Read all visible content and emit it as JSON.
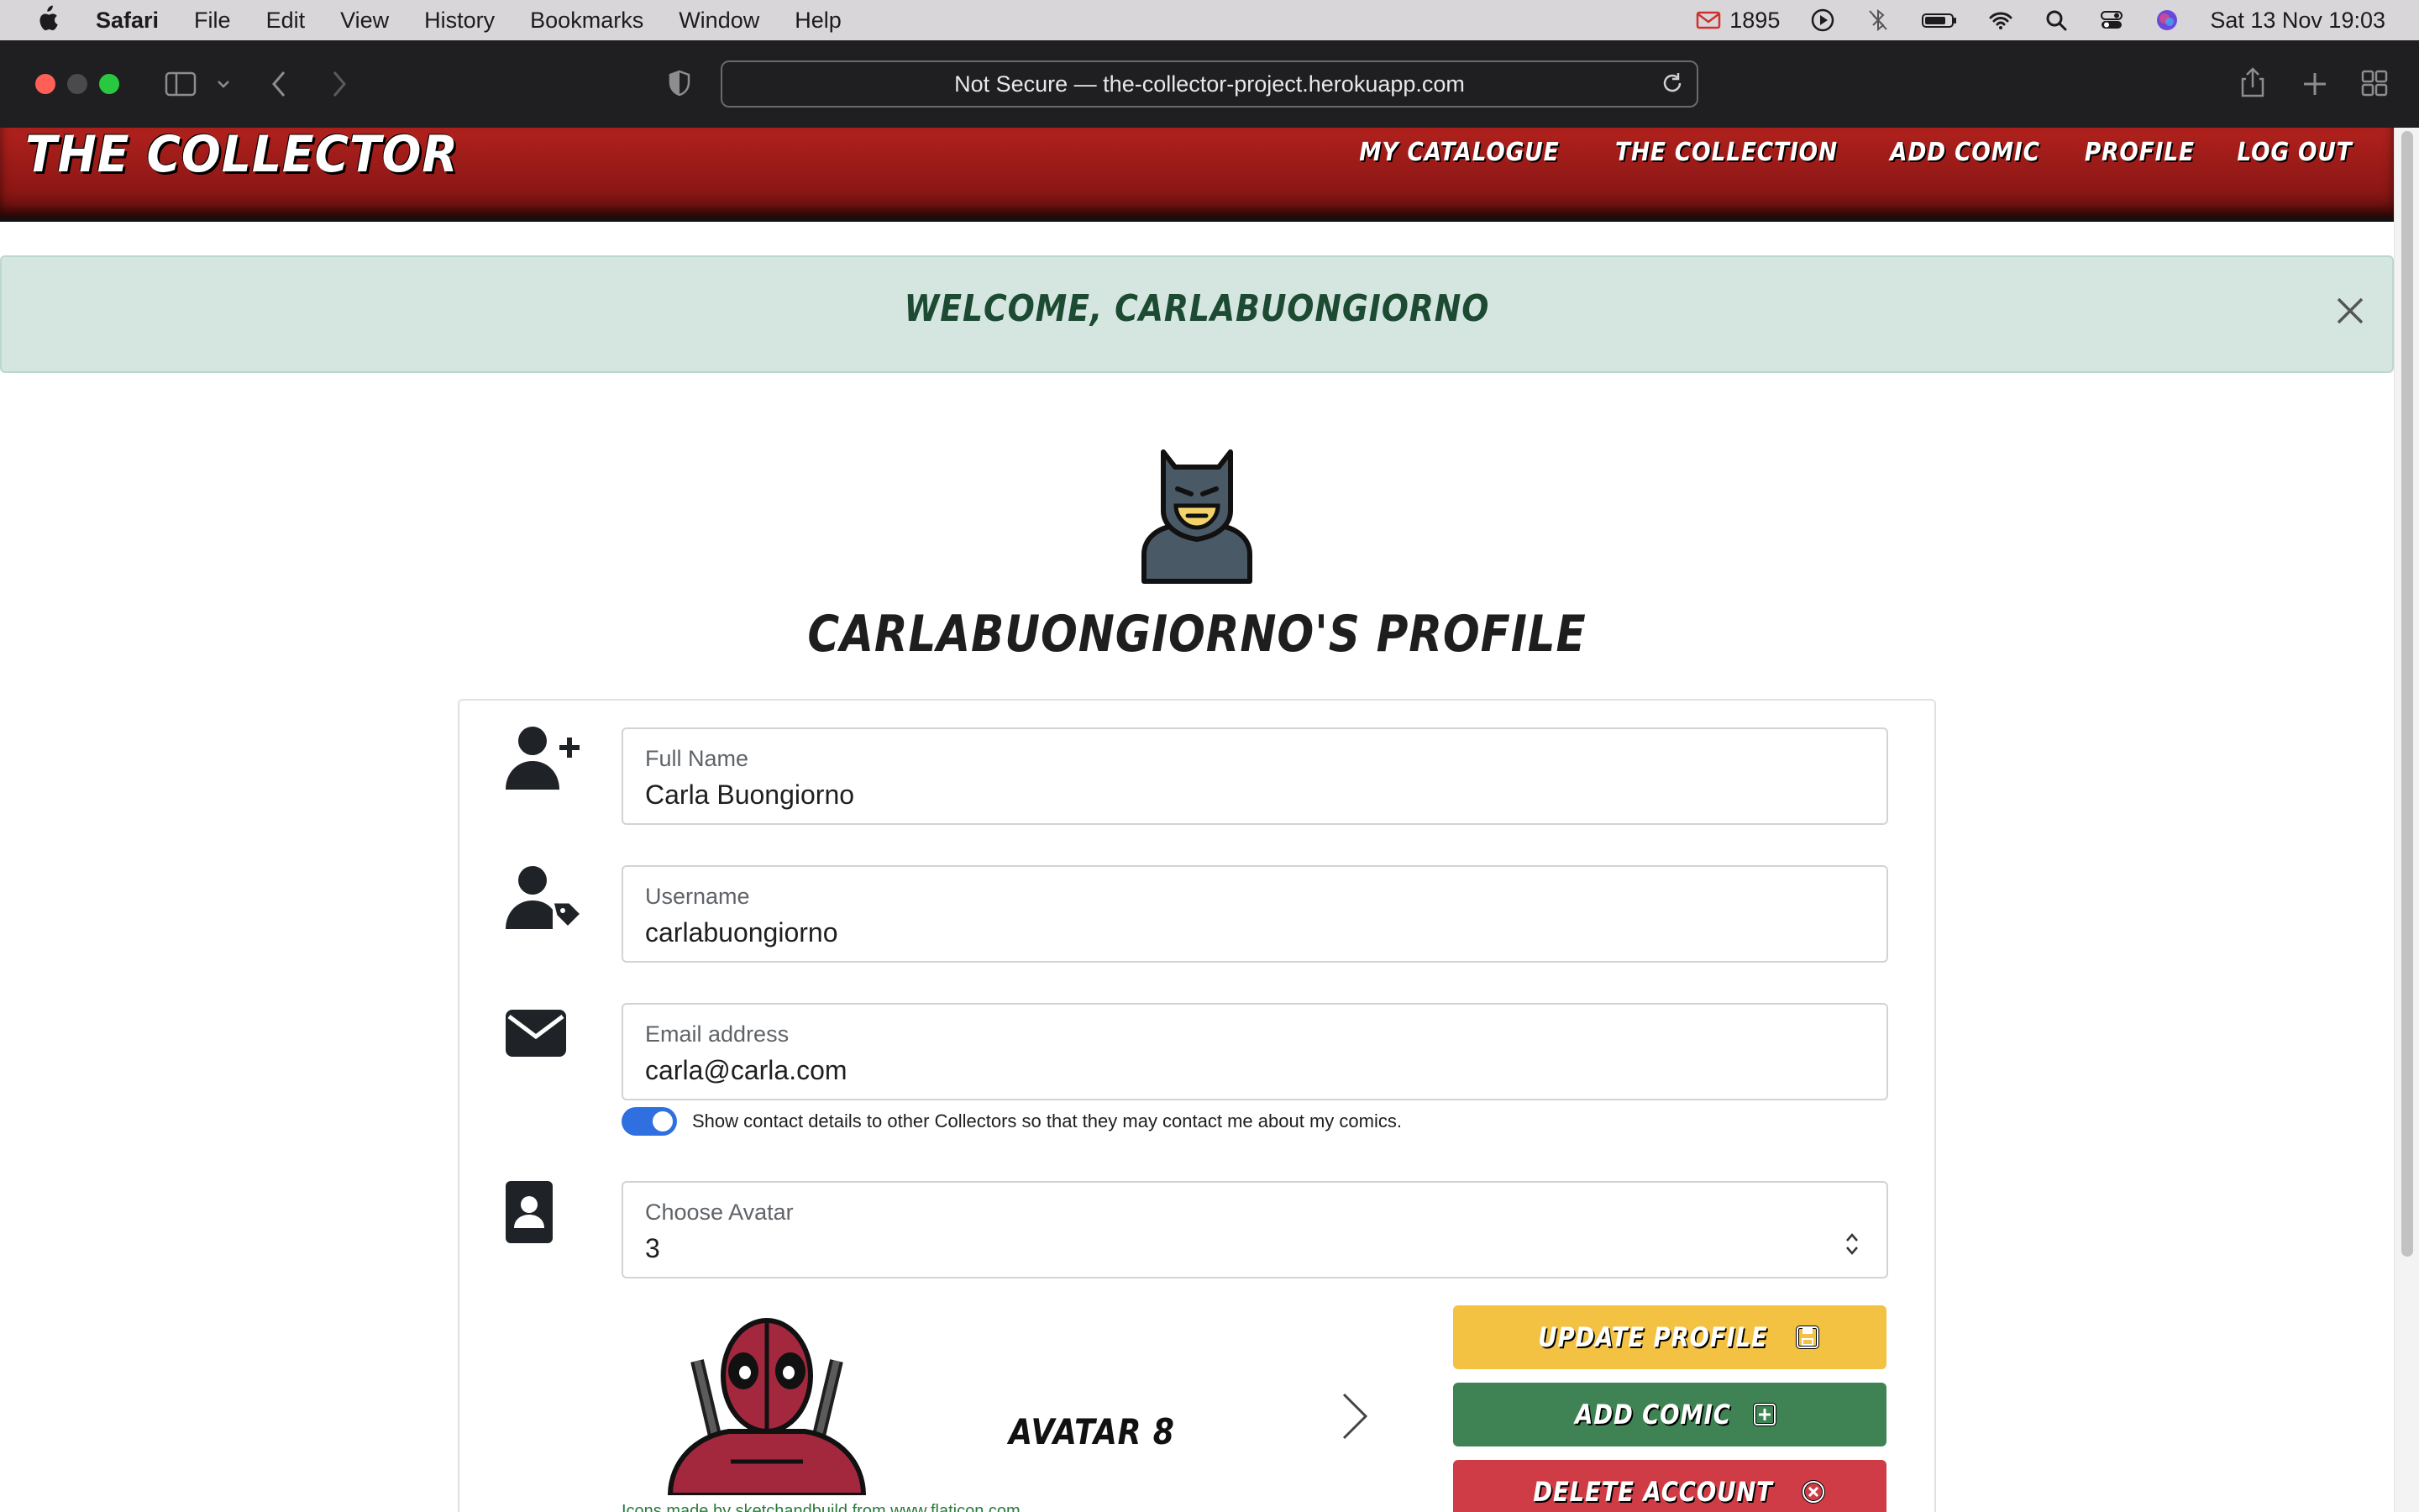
{
  "menubar": {
    "app": "Safari",
    "items": [
      "File",
      "Edit",
      "View",
      "History",
      "Bookmarks",
      "Window",
      "Help"
    ],
    "mail_count": "1895",
    "datetime": "Sat 13 Nov  19:03"
  },
  "browser": {
    "url_text": "Not Secure — the-collector-project.herokuapp.com"
  },
  "site": {
    "brand": "THE COLLECTOR",
    "nav": [
      "MY CATALOGUE",
      "THE COLLECTION",
      "ADD COMIC",
      "PROFILE",
      "LOG OUT"
    ]
  },
  "alert": {
    "message": "WELCOME, CARLABUONGIORNO"
  },
  "profile": {
    "title": "CARLABUONGIORNO'S PROFILE",
    "full_name_label": "Full Name",
    "full_name_value": "Carla Buongiorno",
    "username_label": "Username",
    "username_value": "carlabuongiorno",
    "email_label": "Email address",
    "email_value": "carla@carla.com",
    "contact_toggle_text": "Show contact details to other Collectors so that they may contact me about my comics.",
    "contact_toggle_on": true,
    "avatar_label": "Choose Avatar",
    "avatar_value": "3",
    "carousel_caption": "AVATAR 8",
    "credit_text": "Icons made by sketchandbuild from www.flaticon.com"
  },
  "buttons": {
    "update": "UPDATE PROFILE",
    "add": "ADD COMIC",
    "delete": "DELETE ACCOUNT"
  },
  "colors": {
    "header_red": "#8c1715",
    "alert_bg": "#d4e6df",
    "btn_update": "#f4c243",
    "btn_add": "#3f8253",
    "btn_delete": "#cf3c45",
    "toggle_on": "#2f6fe0"
  }
}
